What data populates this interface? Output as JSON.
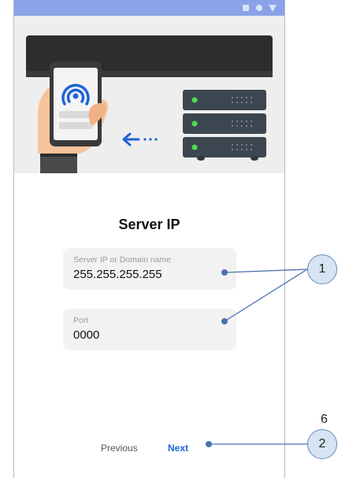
{
  "screen": {
    "title": "Server IP",
    "ip_field": {
      "label": "Server IP  or  Domain name",
      "value": "255.255.255.255"
    },
    "port_field": {
      "label": "Port",
      "value": "0000"
    },
    "buttons": {
      "previous": "Previous",
      "next": "Next"
    }
  },
  "annotations": {
    "callout_1": "1",
    "callout_2": "2",
    "page_number": "6"
  },
  "icons": [
    "wifi-signal-icon",
    "arrow-left-icon",
    "server-icon"
  ],
  "colors": {
    "status_bar": "#8aa3e8",
    "accent": "#1e63d6",
    "callout_fill": "#d6e4f3",
    "callout_line": "#4a72b0"
  }
}
